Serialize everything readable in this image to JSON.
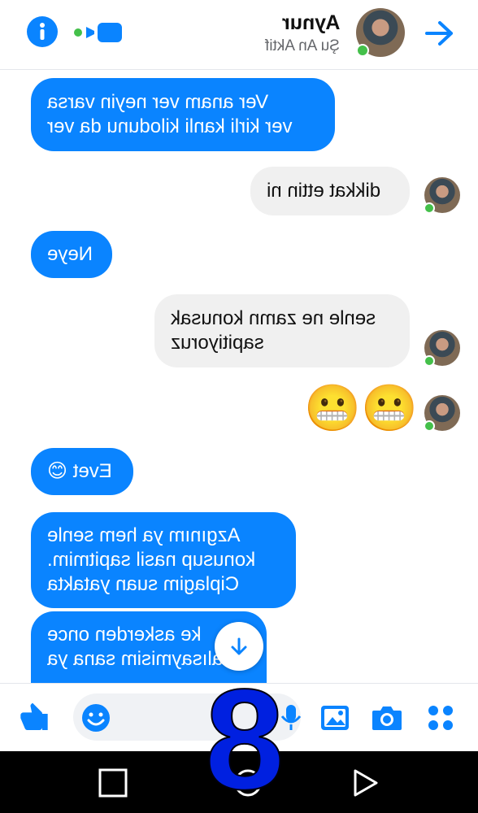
{
  "header": {
    "contact_name": "Aynur",
    "contact_status": "Şu An Aktif",
    "icons": [
      "info-icon",
      "video-call-icon",
      "phone-icon",
      "back-arrow-icon",
      "avatar"
    ]
  },
  "messages": [
    {
      "from": "me",
      "lines": [
        "Ver anam ver neyin varsa",
        "ver kirli kanli kilodunu da ver"
      ]
    },
    {
      "from": "them",
      "lines": [
        "dikkat ettin ni"
      ]
    },
    {
      "from": "me",
      "lines": [
        "Neye"
      ]
    },
    {
      "from": "them",
      "lines": [
        "senle ne zamn konusak",
        "sapitiyoruz"
      ]
    },
    {
      "from": "them",
      "emoji": "😬😬"
    },
    {
      "from": "me",
      "lines": [
        "Evet 😊"
      ]
    },
    {
      "from": "me",
      "lines": [
        "Azgınım ya hem senle",
        "konusup nasil sapitmim.",
        "Ciplagim suan yatakta"
      ]
    },
    {
      "from": "me",
      "lines": [
        "ke askerden once",
        "alısaymisim sana ya"
      ]
    }
  ],
  "composer": {
    "input_placeholder": "",
    "icons": [
      "like-icon",
      "emoji-icon",
      "mic-icon",
      "gallery-icon",
      "camera-icon",
      "more-apps-icon"
    ]
  },
  "overlay": {
    "digit": "8"
  },
  "colors": {
    "accent": "#0a84ff",
    "received_bubble": "#f0f0f0",
    "online": "#44c04a",
    "nav_bar": "#000000"
  }
}
